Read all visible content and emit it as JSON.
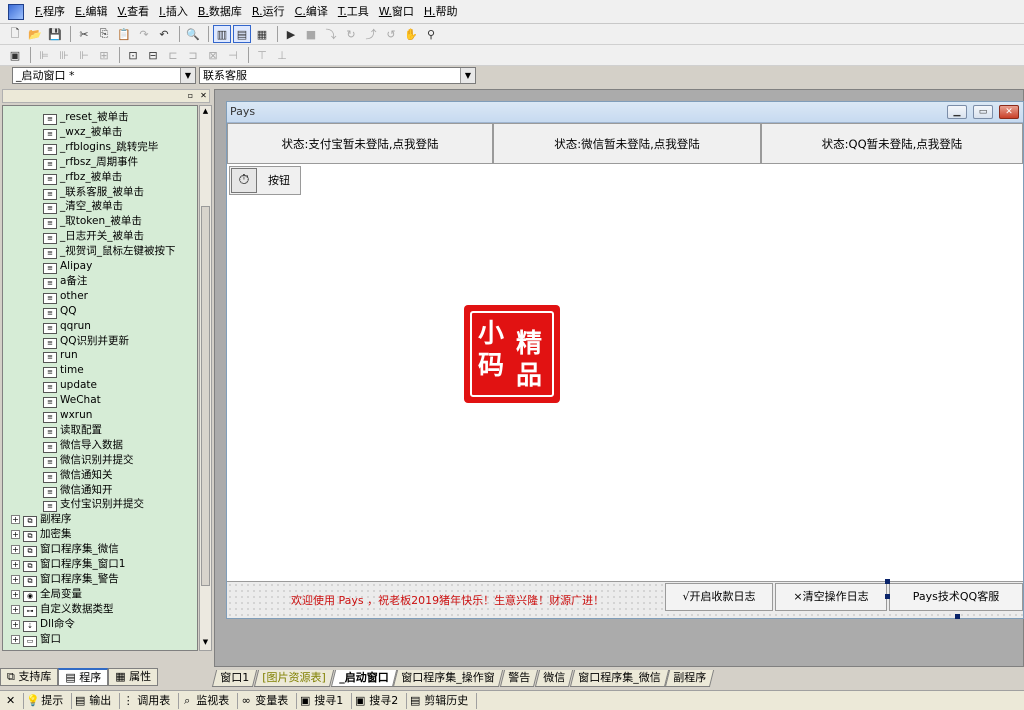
{
  "menu": [
    "F.程序",
    "E.编辑",
    "V.查看",
    "I.插入",
    "B.数据库",
    "R.运行",
    "C.编译",
    "T.工具",
    "W.窗口",
    "H.帮助"
  ],
  "toolbar1": [
    "new-icon",
    "open-icon",
    "save-icon",
    "cut-icon",
    "copy-icon",
    "paste-icon",
    "redo-icon",
    "undo-icon",
    "find-icon",
    "layout-1-icon",
    "layout-2-icon",
    "layout-3-icon",
    "run-icon",
    "stop-icon",
    "step-into-icon",
    "step-over-icon",
    "step-out-icon",
    "step-cursor-icon",
    "hand-icon",
    "binocular-icon"
  ],
  "toolbar2": [
    "form-icon",
    "align-left-icon",
    "align-center-icon",
    "align-right-icon",
    "align-grid-icon",
    "center-h-icon",
    "center-v-icon",
    "same-width-icon",
    "same-height-icon",
    "same-size-icon",
    "spread-h-icon",
    "spread-v-icon",
    "space-icon"
  ],
  "combo_left": "_启动窗口 *",
  "combo_right": "联系客服",
  "tree": [
    {
      "icon": "subroutine",
      "label": "_reset_被单击"
    },
    {
      "icon": "subroutine",
      "label": "_wxz_被单击"
    },
    {
      "icon": "subroutine",
      "label": "_rfblogins_跳转完毕"
    },
    {
      "icon": "subroutine",
      "label": "_rfbsz_周期事件"
    },
    {
      "icon": "subroutine",
      "label": "_rfbz_被单击"
    },
    {
      "icon": "subroutine",
      "label": "_联系客服_被单击"
    },
    {
      "icon": "subroutine",
      "label": "_清空_被单击"
    },
    {
      "icon": "subroutine",
      "label": "_取token_被单击"
    },
    {
      "icon": "subroutine",
      "label": "_日志开关_被单击"
    },
    {
      "icon": "subroutine",
      "label": "_视贺词_鼠标左键被按下"
    },
    {
      "icon": "subroutine",
      "label": "Alipay"
    },
    {
      "icon": "subroutine",
      "label": "a备注"
    },
    {
      "icon": "subroutine",
      "label": "other"
    },
    {
      "icon": "subroutine",
      "label": "QQ"
    },
    {
      "icon": "subroutine",
      "label": "qqrun"
    },
    {
      "icon": "subroutine",
      "label": "QQ识别并更新"
    },
    {
      "icon": "subroutine",
      "label": "run"
    },
    {
      "icon": "subroutine",
      "label": "time"
    },
    {
      "icon": "subroutine",
      "label": "update"
    },
    {
      "icon": "subroutine",
      "label": "WeChat"
    },
    {
      "icon": "subroutine",
      "label": "wxrun"
    },
    {
      "icon": "subroutine",
      "label": "读取配置"
    },
    {
      "icon": "subroutine",
      "label": "微信导入数据"
    },
    {
      "icon": "subroutine",
      "label": "微信识别并提交"
    },
    {
      "icon": "subroutine",
      "label": "微信通知关"
    },
    {
      "icon": "subroutine",
      "label": "微信通知开"
    },
    {
      "icon": "subroutine",
      "label": "支付宝识别并提交"
    },
    {
      "icon": "module",
      "label": "副程序"
    },
    {
      "icon": "module",
      "label": "加密集"
    },
    {
      "icon": "module",
      "label": "窗口程序集_微信"
    },
    {
      "icon": "module",
      "label": "窗口程序集_窗口1"
    },
    {
      "icon": "module",
      "label": "窗口程序集_警告"
    },
    {
      "icon": "global",
      "label": "全局变量"
    },
    {
      "icon": "datatype",
      "label": "自定义数据类型"
    },
    {
      "icon": "dll",
      "label": "Dll命令"
    },
    {
      "icon": "window",
      "label": "窗口"
    }
  ],
  "bottom_tabs": [
    "支持库",
    "程序",
    "属性"
  ],
  "form": {
    "title": "Pays",
    "status": [
      "状态:支付宝暂未登陆,点我登陆",
      "状态:微信暂未登陆,点我登陆",
      "状态:QQ暂未登陆,点我登陆"
    ],
    "timer_button": "按钮",
    "seal_chars": [
      "小",
      "精",
      "码",
      "品"
    ],
    "marquee": "欢迎使用 Pays ，祝老板2019猪年快乐！生意兴隆！财源广进！",
    "buttons": [
      "√开启收款日志",
      "×清空操作日志",
      "Pays技术QQ客服"
    ]
  },
  "doc_tabs": [
    "窗口1",
    "[图片资源表]",
    "_启动窗口",
    "窗口程序集_操作窗",
    "警告",
    "微信",
    "窗口程序集_微信",
    "副程序"
  ],
  "status_items": [
    {
      "icon": "tip-icon",
      "label": "提示"
    },
    {
      "icon": "output-icon",
      "label": "输出"
    },
    {
      "icon": "call-table-icon",
      "label": "调用表"
    },
    {
      "icon": "watch-icon",
      "label": "监视表"
    },
    {
      "icon": "var-table-icon",
      "label": "变量表"
    },
    {
      "icon": "search1-icon",
      "label": "搜寻1"
    },
    {
      "icon": "search2-icon",
      "label": "搜寻2"
    },
    {
      "icon": "clipboard-icon",
      "label": "剪辑历史"
    }
  ]
}
